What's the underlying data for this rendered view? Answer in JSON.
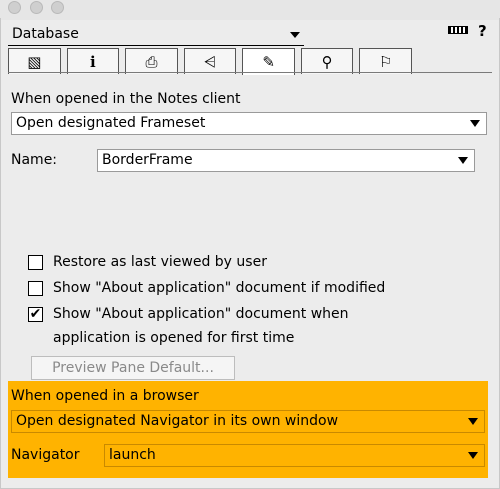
{
  "header": {
    "object_type": "Database",
    "tabs": [
      {
        "name": "basics-tab",
        "icon": "database-icon",
        "glyph": "▧"
      },
      {
        "name": "info-tab",
        "icon": "info-icon",
        "glyph": "i"
      },
      {
        "name": "printing-tab",
        "icon": "printer-icon",
        "glyph": "⎙"
      },
      {
        "name": "design-tab",
        "icon": "design-icon",
        "glyph": "⩤"
      },
      {
        "name": "launch-tab",
        "icon": "rocket-icon",
        "glyph": "✎"
      },
      {
        "name": "search-tab",
        "icon": "magnifier-icon",
        "glyph": "⚲"
      },
      {
        "name": "advanced-tab",
        "icon": "propeller-hat-icon",
        "glyph": "⚐"
      }
    ]
  },
  "notes_client": {
    "section_label": "When opened in the Notes client",
    "on_open_value": "Open designated Frameset",
    "name_label": "Name:",
    "name_value": "BorderFrame"
  },
  "options": {
    "restore_label": "Restore as last viewed by user",
    "restore_checked": false,
    "about_if_modified_label": "Show \"About application\" document if modified",
    "about_if_modified_checked": false,
    "about_first_time_label_line1": "Show \"About application\" document when",
    "about_first_time_label_line2": "application is opened for first time",
    "about_first_time_checked": true,
    "check_mark": "✔",
    "preview_button_label": "Preview Pane Default..."
  },
  "browser": {
    "section_label": "When opened in a browser",
    "on_open_value": "Open designated Navigator in its own window",
    "navigator_label": "Navigator",
    "navigator_value": "launch",
    "highlight_color": "#ffb300"
  }
}
